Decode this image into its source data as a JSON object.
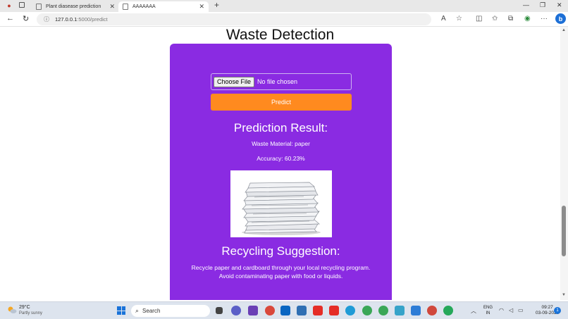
{
  "browser": {
    "tabs": [
      {
        "title": "Plant diasease prediction",
        "active": false
      },
      {
        "title": "AAAAAAA",
        "active": true
      }
    ],
    "url_host": "127.0.0.1",
    "url_rest": ":5000/predict"
  },
  "page": {
    "title": "Waste Detection",
    "file_button": "Choose File",
    "file_status": "No file chosen",
    "predict_label": "Predict",
    "result_heading": "Prediction Result:",
    "material_line": "Waste Material: paper",
    "accuracy_line": "Accuracy: 60.23%",
    "suggestion_heading": "Recycling Suggestion:",
    "suggestion_line1": "Recycle paper and cardboard through your local recycling program.",
    "suggestion_line2": "Avoid contaminating paper with food or liquids."
  },
  "taskbar": {
    "weather_temp": "29°C",
    "weather_desc": "Partly sunny",
    "search_label": "Search",
    "lang_top": "ENG",
    "lang_bottom": "IN",
    "time": "09:27",
    "date": "03-09-2023",
    "notifications": "1"
  },
  "colors": {
    "card_bg": "#8a2be2",
    "predict_button": "#ff8a1f",
    "taskbar": "#dde4ee"
  }
}
